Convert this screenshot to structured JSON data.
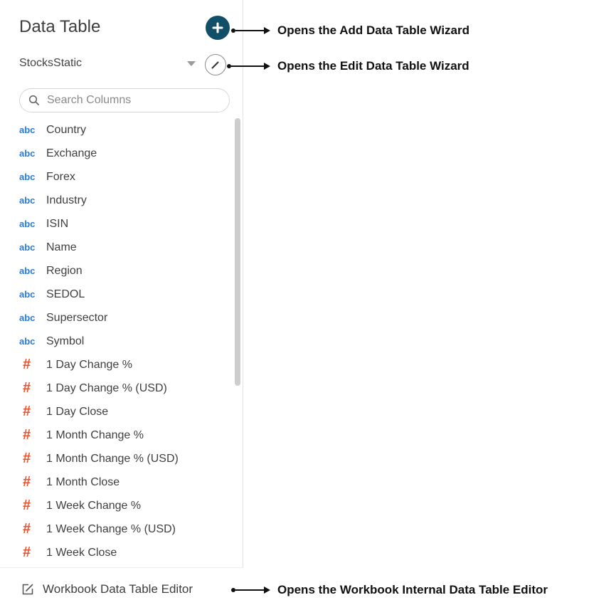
{
  "panel": {
    "title": "Data Table",
    "selected_table": "StocksStatic",
    "search_placeholder": "Search Columns",
    "columns": [
      {
        "type": "abc",
        "name": "Country"
      },
      {
        "type": "abc",
        "name": "Exchange"
      },
      {
        "type": "abc",
        "name": "Forex"
      },
      {
        "type": "abc",
        "name": "Industry"
      },
      {
        "type": "abc",
        "name": "ISIN"
      },
      {
        "type": "abc",
        "name": "Name"
      },
      {
        "type": "abc",
        "name": "Region"
      },
      {
        "type": "abc",
        "name": "SEDOL"
      },
      {
        "type": "abc",
        "name": "Supersector"
      },
      {
        "type": "abc",
        "name": "Symbol"
      },
      {
        "type": "#",
        "name": "1 Day Change %"
      },
      {
        "type": "#",
        "name": "1 Day Change % (USD)"
      },
      {
        "type": "#",
        "name": "1 Day Close"
      },
      {
        "type": "#",
        "name": "1 Month Change %"
      },
      {
        "type": "#",
        "name": "1 Month Change % (USD)"
      },
      {
        "type": "#",
        "name": "1 Month Close"
      },
      {
        "type": "#",
        "name": "1 Week Change %"
      },
      {
        "type": "#",
        "name": "1 Week Change % (USD)"
      },
      {
        "type": "#",
        "name": "1 Week Close"
      }
    ],
    "footer_link": "Workbook Data Table Editor"
  },
  "annotations": {
    "add": "Opens the Add Data Table Wizard",
    "edit": "Opens the Edit Data Table Wizard",
    "editor": "Opens the Workbook Internal Data Table Editor"
  },
  "colors": {
    "add_button": "#114f68",
    "text_type": "#2a7bd6",
    "numeric_type": "#ef4f2b"
  },
  "icons": {
    "add": "plus-icon",
    "edit": "pencil-icon",
    "dropdown": "caret-down-icon",
    "search": "search-icon",
    "editor": "edit-window-icon"
  }
}
